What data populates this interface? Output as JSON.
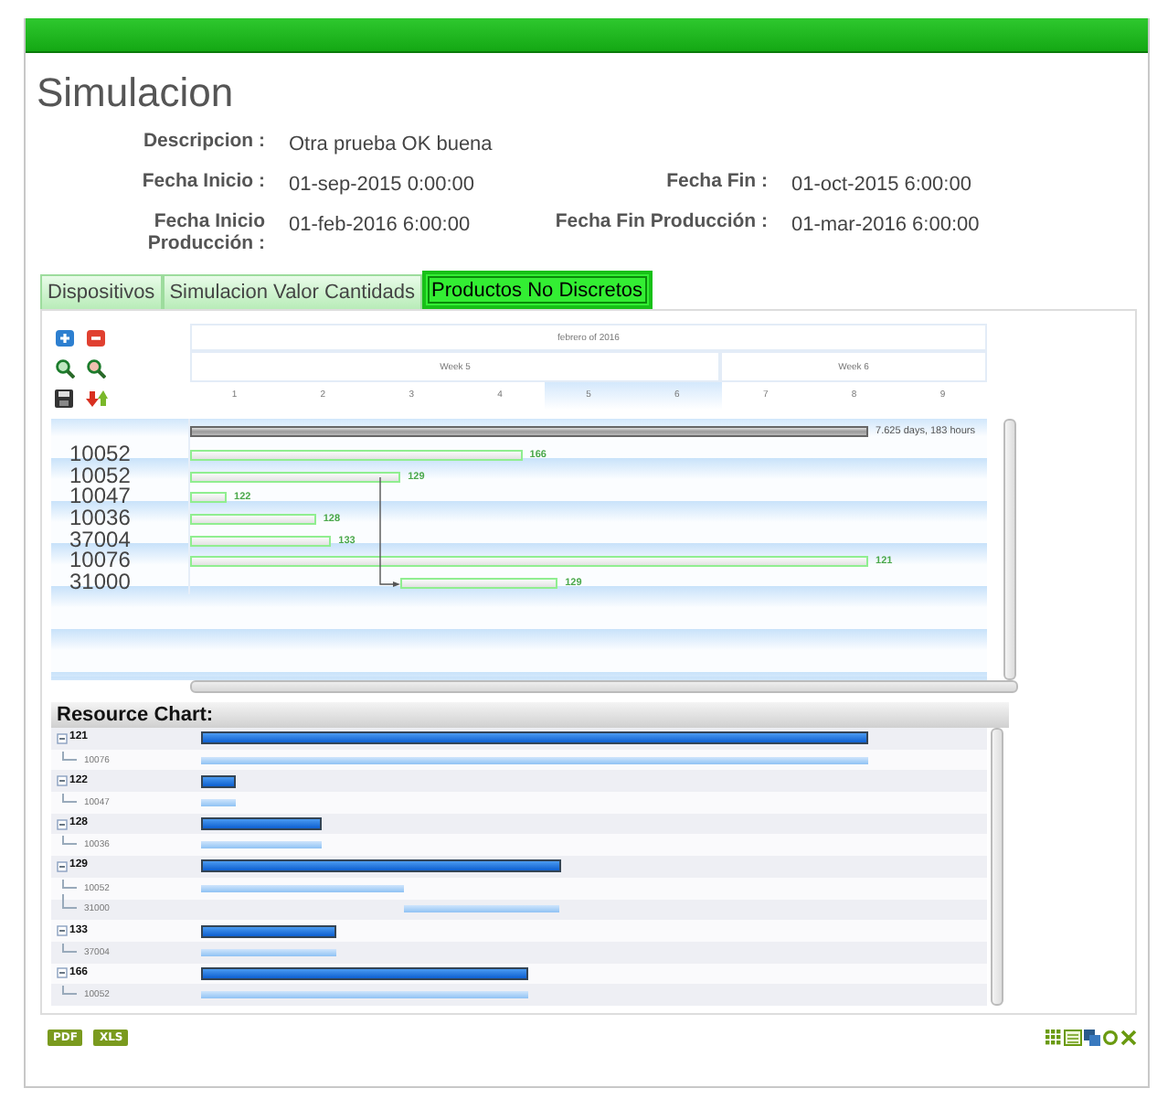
{
  "page": {
    "title": "Simulacion"
  },
  "details": [
    {
      "label": "Descripcion :",
      "value": "Otra prueba OK buena"
    },
    {
      "label": "Fecha Inicio :",
      "value": "01-sep-2015 0:00:00"
    },
    {
      "label": "Fecha Fin :",
      "value": "01-oct-2015 6:00:00"
    },
    {
      "label": "Fecha Inicio Producción :",
      "value": "01-feb-2016 6:00:00"
    },
    {
      "label": "Fecha Fin Producción :",
      "value": "01-mar-2016 6:00:00"
    }
  ],
  "tabs": [
    {
      "label": "Dispositivos",
      "selected": false
    },
    {
      "label": "Simulacion Valor Cantidads",
      "selected": false
    },
    {
      "label": "Productos No Discretos",
      "selected": true
    }
  ],
  "gantt": {
    "month": "febrero of 2016",
    "weeks": [
      {
        "label": "Week 5",
        "days": [
          {
            "label": "1",
            "selected": false
          },
          {
            "label": "2",
            "selected": false
          },
          {
            "label": "3",
            "selected": false
          },
          {
            "label": "4",
            "selected": false
          },
          {
            "label": "5",
            "selected": true
          },
          {
            "label": "6",
            "selected": true
          }
        ]
      },
      {
        "label": "Week 6",
        "days": [
          {
            "label": "7",
            "selected": false
          },
          {
            "label": "8",
            "selected": false
          },
          {
            "label": "9",
            "selected": false
          }
        ]
      }
    ],
    "summary": {
      "label": "7.625 days, 183 hours"
    },
    "tasks": [
      {
        "label": "10052",
        "resource": "166"
      },
      {
        "label": "10052",
        "resource": "129",
        "successors": [
          {
            "label": "31000",
            "resource": "129"
          }
        ]
      },
      {
        "label": "10047",
        "resource": "122"
      },
      {
        "label": "10036",
        "resource": "128"
      },
      {
        "label": "37004",
        "resource": "133"
      },
      {
        "label": "10076",
        "resource": "121"
      }
    ]
  },
  "resource_chart": {
    "title": "Resource Chart:",
    "groups": [
      {
        "label": "121",
        "expanded": true,
        "children": [
          {
            "label": "10076",
            "kind": "from_start"
          }
        ]
      },
      {
        "label": "122",
        "expanded": true,
        "children": [
          {
            "label": "10047",
            "kind": "from_start"
          }
        ]
      },
      {
        "label": "128",
        "expanded": true,
        "children": [
          {
            "label": "10036",
            "kind": "from_start"
          }
        ]
      },
      {
        "label": "129",
        "expanded": true,
        "children": [
          {
            "label": "10052",
            "kind": "from_start"
          },
          {
            "label": "31000",
            "kind": "after_previous"
          }
        ]
      },
      {
        "label": "133",
        "expanded": true,
        "children": [
          {
            "label": "37004",
            "kind": "from_start"
          }
        ]
      },
      {
        "label": "166",
        "expanded": true,
        "children": [
          {
            "label": "10052",
            "kind": "from_start"
          }
        ]
      }
    ]
  },
  "exports": [
    "PDF",
    "XLS"
  ]
}
